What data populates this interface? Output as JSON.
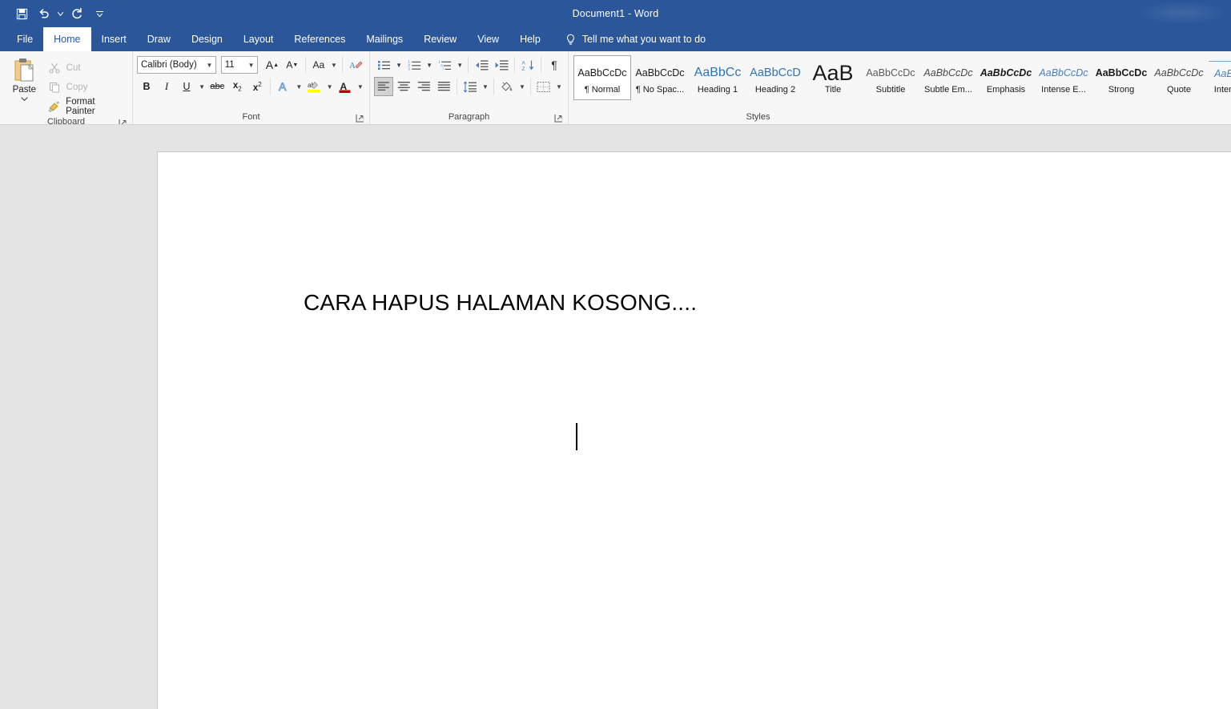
{
  "window": {
    "title": "Document1  -  Word"
  },
  "quick_access": [
    {
      "name": "save-button",
      "icon": "save-icon",
      "label": "Save"
    },
    {
      "name": "undo-button",
      "icon": "undo-icon",
      "label": "Undo"
    },
    {
      "name": "redo-button",
      "icon": "redo-icon",
      "label": "Redo"
    },
    {
      "name": "customize-qat-button",
      "icon": "chevron-down-icon",
      "label": "Customize Quick Access Toolbar"
    }
  ],
  "tabs": [
    {
      "label": "File",
      "active": false
    },
    {
      "label": "Home",
      "active": true
    },
    {
      "label": "Insert",
      "active": false
    },
    {
      "label": "Draw",
      "active": false
    },
    {
      "label": "Design",
      "active": false
    },
    {
      "label": "Layout",
      "active": false
    },
    {
      "label": "References",
      "active": false
    },
    {
      "label": "Mailings",
      "active": false
    },
    {
      "label": "Review",
      "active": false
    },
    {
      "label": "View",
      "active": false
    },
    {
      "label": "Help",
      "active": false
    }
  ],
  "tell_me": {
    "label": "Tell me what you want to do",
    "icon": "lightbulb-icon"
  },
  "ribbon": {
    "clipboard": {
      "label": "Clipboard",
      "paste_label": "Paste",
      "items": [
        {
          "label": "Cut",
          "icon": "scissors-icon",
          "disabled": true
        },
        {
          "label": "Copy",
          "icon": "copy-icon",
          "disabled": true
        },
        {
          "label": "Format Painter",
          "icon": "paintbrush-icon",
          "disabled": false
        }
      ]
    },
    "font": {
      "label": "Font",
      "font_name": "Calibri (Body)",
      "font_size": "11",
      "row1": [
        {
          "name": "grow-font-button",
          "glyph": "A",
          "sup": "▲"
        },
        {
          "name": "shrink-font-button",
          "glyph": "A",
          "sup": "▼"
        },
        {
          "name": "change-case-button",
          "glyph": "Aa",
          "caret": true
        },
        {
          "name": "clear-formatting-button",
          "glyph": "A",
          "sup": ""
        }
      ],
      "row2": [
        {
          "name": "bold-button",
          "glyph": "B"
        },
        {
          "name": "italic-button",
          "glyph": "I"
        },
        {
          "name": "underline-button",
          "glyph": "U",
          "caret": true
        },
        {
          "name": "strikethrough-button",
          "glyph": "abc"
        },
        {
          "name": "subscript-button",
          "glyph": "x₂"
        },
        {
          "name": "superscript-button",
          "glyph": "x²"
        },
        {
          "name": "text-effects-button",
          "glyph": "A",
          "caret": true
        },
        {
          "name": "text-highlight-color-button",
          "glyph": "ab",
          "caret": true
        },
        {
          "name": "font-color-button",
          "glyph": "A",
          "caret": true
        }
      ]
    },
    "paragraph": {
      "label": "Paragraph",
      "row1": [
        {
          "name": "bullets-button",
          "icon": "bullet-list-icon",
          "caret": true
        },
        {
          "name": "numbering-button",
          "icon": "numbered-list-icon",
          "caret": true
        },
        {
          "name": "multilevel-list-button",
          "icon": "multilevel-list-icon",
          "caret": true
        },
        {
          "name": "decrease-indent-button",
          "icon": "decrease-indent-icon"
        },
        {
          "name": "increase-indent-button",
          "icon": "increase-indent-icon"
        },
        {
          "name": "sort-button",
          "icon": "sort-az-icon"
        },
        {
          "name": "show-formatting-marks-button",
          "icon": "pilcrow-icon"
        }
      ],
      "row2": [
        {
          "name": "align-left-button",
          "icon": "align-left-icon",
          "selected": true
        },
        {
          "name": "align-center-button",
          "icon": "align-center-icon"
        },
        {
          "name": "align-right-button",
          "icon": "align-right-icon"
        },
        {
          "name": "justify-button",
          "icon": "justify-icon"
        },
        {
          "name": "line-spacing-button",
          "icon": "line-spacing-icon",
          "caret": true
        },
        {
          "name": "shading-button",
          "icon": "paint-bucket-icon",
          "caret": true
        },
        {
          "name": "borders-button",
          "icon": "borders-icon",
          "caret": true
        }
      ]
    },
    "styles": {
      "label": "Styles",
      "items": [
        {
          "preview": "AaBbCcDc",
          "name": "¶ Normal",
          "selected": true,
          "style": "normal"
        },
        {
          "preview": "AaBbCcDc",
          "name": "¶ No Spac...",
          "selected": false,
          "style": "normal"
        },
        {
          "preview": "AaBbCc",
          "name": "Heading 1",
          "selected": false,
          "style": "heading1"
        },
        {
          "preview": "AaBbCcD",
          "name": "Heading 2",
          "selected": false,
          "style": "heading2"
        },
        {
          "preview": "AaB",
          "name": "Title",
          "selected": false,
          "style": "title"
        },
        {
          "preview": "AaBbCcDc",
          "name": "Subtitle",
          "selected": false,
          "style": "subtitle"
        },
        {
          "preview": "AaBbCcDc",
          "name": "Subtle Em...",
          "selected": false,
          "style": "italic"
        },
        {
          "preview": "AaBbCcDc",
          "name": "Emphasis",
          "selected": false,
          "style": "bolditalic"
        },
        {
          "preview": "AaBbCcDc",
          "name": "Intense E...",
          "selected": false,
          "style": "blueitalic"
        },
        {
          "preview": "AaBbCcDc",
          "name": "Strong",
          "selected": false,
          "style": "bold"
        },
        {
          "preview": "AaBbCcDc",
          "name": "Quote",
          "selected": false,
          "style": "italic"
        },
        {
          "preview": "AaB",
          "name": "Inten",
          "selected": false,
          "style": "blueitalic"
        }
      ]
    }
  },
  "document": {
    "text": "CARA HAPUS HALAMAN KOSONG...."
  },
  "colors": {
    "brand": "#2b579a",
    "ribbon_bg": "#f7f7f7",
    "workspace_bg": "#e4e4e4",
    "heading_blue": "#2e74b5",
    "accent_red": "#c00000",
    "highlight_yellow": "#ffff00"
  }
}
